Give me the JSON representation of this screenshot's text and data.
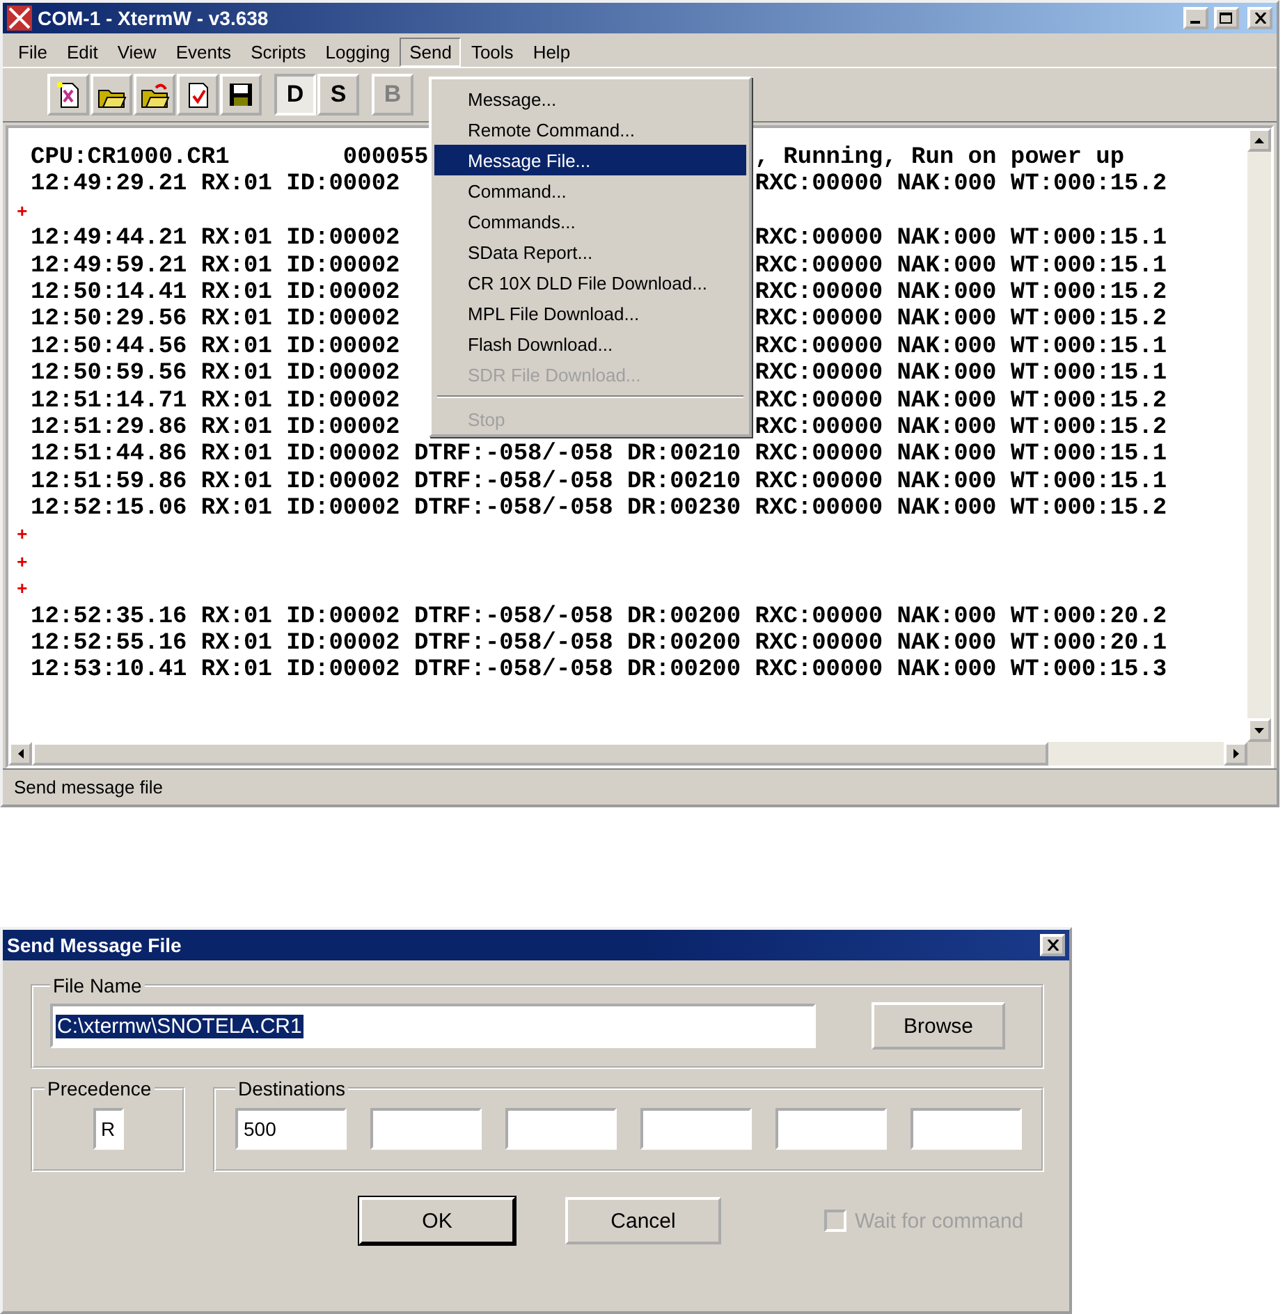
{
  "window": {
    "title": "COM-1 - XtermW - v3.638"
  },
  "menu_bar": [
    {
      "label": "File",
      "selected": false
    },
    {
      "label": "Edit",
      "selected": false
    },
    {
      "label": "View",
      "selected": false
    },
    {
      "label": "Events",
      "selected": false
    },
    {
      "label": "Scripts",
      "selected": false
    },
    {
      "label": "Logging",
      "selected": false
    },
    {
      "label": "Send",
      "selected": true
    },
    {
      "label": "Tools",
      "selected": false
    },
    {
      "label": "Help",
      "selected": false
    }
  ],
  "toolbar": [
    {
      "label": "D",
      "pressed": true,
      "disabled": false
    },
    {
      "label": "S",
      "pressed": false,
      "disabled": false
    },
    {
      "label": "B",
      "pressed": false,
      "disabled": true
    }
  ],
  "send_menu": [
    {
      "kind": "item",
      "label": "Message...",
      "selected": false,
      "disabled": false
    },
    {
      "kind": "item",
      "label": "Remote Command...",
      "selected": false,
      "disabled": false
    },
    {
      "kind": "item",
      "label": "Message File...",
      "selected": true,
      "disabled": false
    },
    {
      "kind": "item",
      "label": "Command...",
      "selected": false,
      "disabled": false
    },
    {
      "kind": "item",
      "label": "Commands...",
      "selected": false,
      "disabled": false
    },
    {
      "kind": "item",
      "label": "SData Report...",
      "selected": false,
      "disabled": false
    },
    {
      "kind": "item",
      "label": "CR 10X DLD File Download...",
      "selected": false,
      "disabled": false
    },
    {
      "kind": "item",
      "label": "MPL File Download...",
      "selected": false,
      "disabled": false
    },
    {
      "kind": "item",
      "label": "Flash Download...",
      "selected": false,
      "disabled": false
    },
    {
      "kind": "item",
      "label": "SDR File Download...",
      "selected": false,
      "disabled": true
    },
    {
      "kind": "separator"
    },
    {
      "kind": "item",
      "label": "Stop",
      "selected": false,
      "disabled": true
    }
  ],
  "terminal": [
    {
      "kind": "split",
      "left": "CPU:CR1000.CR1        000055",
      "right": ", Running, Run on power up"
    },
    {
      "kind": "split",
      "left": "12:49:29.21 RX:01 ID:00002",
      "right": "RXC:00000 NAK:000 WT:000:15.2"
    },
    {
      "kind": "marker",
      "text": "+"
    },
    {
      "kind": "split",
      "left": "12:49:44.21 RX:01 ID:00002",
      "right": "RXC:00000 NAK:000 WT:000:15.1"
    },
    {
      "kind": "split",
      "left": "12:49:59.21 RX:01 ID:00002",
      "right": "RXC:00000 NAK:000 WT:000:15.1"
    },
    {
      "kind": "split",
      "left": "12:50:14.41 RX:01 ID:00002",
      "right": "RXC:00000 NAK:000 WT:000:15.2"
    },
    {
      "kind": "split",
      "left": "12:50:29.56 RX:01 ID:00002",
      "right": "RXC:00000 NAK:000 WT:000:15.2"
    },
    {
      "kind": "split",
      "left": "12:50:44.56 RX:01 ID:00002",
      "right": "RXC:00000 NAK:000 WT:000:15.1"
    },
    {
      "kind": "split",
      "left": "12:50:59.56 RX:01 ID:00002",
      "right": "RXC:00000 NAK:000 WT:000:15.1"
    },
    {
      "kind": "split",
      "left": "12:51:14.71 RX:01 ID:00002",
      "right": "RXC:00000 NAK:000 WT:000:15.2"
    },
    {
      "kind": "split",
      "left": "12:51:29.86 RX:01 ID:00002",
      "right": "RXC:00000 NAK:000 WT:000:15.2"
    },
    {
      "kind": "full",
      "text": "12:51:44.86 RX:01 ID:00002 DTRF:-058/-058 DR:00210 RXC:00000 NAK:000 WT:000:15.1"
    },
    {
      "kind": "full",
      "text": "12:51:59.86 RX:01 ID:00002 DTRF:-058/-058 DR:00210 RXC:00000 NAK:000 WT:000:15.1"
    },
    {
      "kind": "full",
      "text": "12:52:15.06 RX:01 ID:00002 DTRF:-058/-058 DR:00230 RXC:00000 NAK:000 WT:000:15.2"
    },
    {
      "kind": "marker",
      "text": "+"
    },
    {
      "kind": "marker",
      "text": "+"
    },
    {
      "kind": "marker",
      "text": "+"
    },
    {
      "kind": "full",
      "text": "12:52:35.16 RX:01 ID:00002 DTRF:-058/-058 DR:00200 RXC:00000 NAK:000 WT:000:20.2"
    },
    {
      "kind": "full",
      "text": "12:52:55.16 RX:01 ID:00002 DTRF:-058/-058 DR:00200 RXC:00000 NAK:000 WT:000:20.1"
    },
    {
      "kind": "full",
      "text": "12:53:10.41 RX:01 ID:00002 DTRF:-058/-058 DR:00200 RXC:00000 NAK:000 WT:000:15.3"
    }
  ],
  "status_bar": "Send message file",
  "dialog": {
    "title": "Send Message File",
    "file_name": {
      "label": "File Name",
      "value": "C:\\xtermw\\SNOTELA.CR1",
      "selected": true,
      "button": "Browse"
    },
    "precedence": {
      "label": "Precedence",
      "value": "R"
    },
    "destinations": {
      "label": "Destinations",
      "fields": [
        {
          "value": "500",
          "enabled": true
        },
        {
          "enabled": true
        },
        {
          "enabled": true
        },
        {
          "enabled": true
        },
        {
          "enabled": true
        },
        {
          "enabled": true
        }
      ]
    },
    "buttons": [
      {
        "label": "OK",
        "default": true
      },
      {
        "label": "Cancel",
        "default": false
      }
    ],
    "wait_checkbox": {
      "label": "Wait for command",
      "checked": false,
      "disabled": true
    }
  }
}
